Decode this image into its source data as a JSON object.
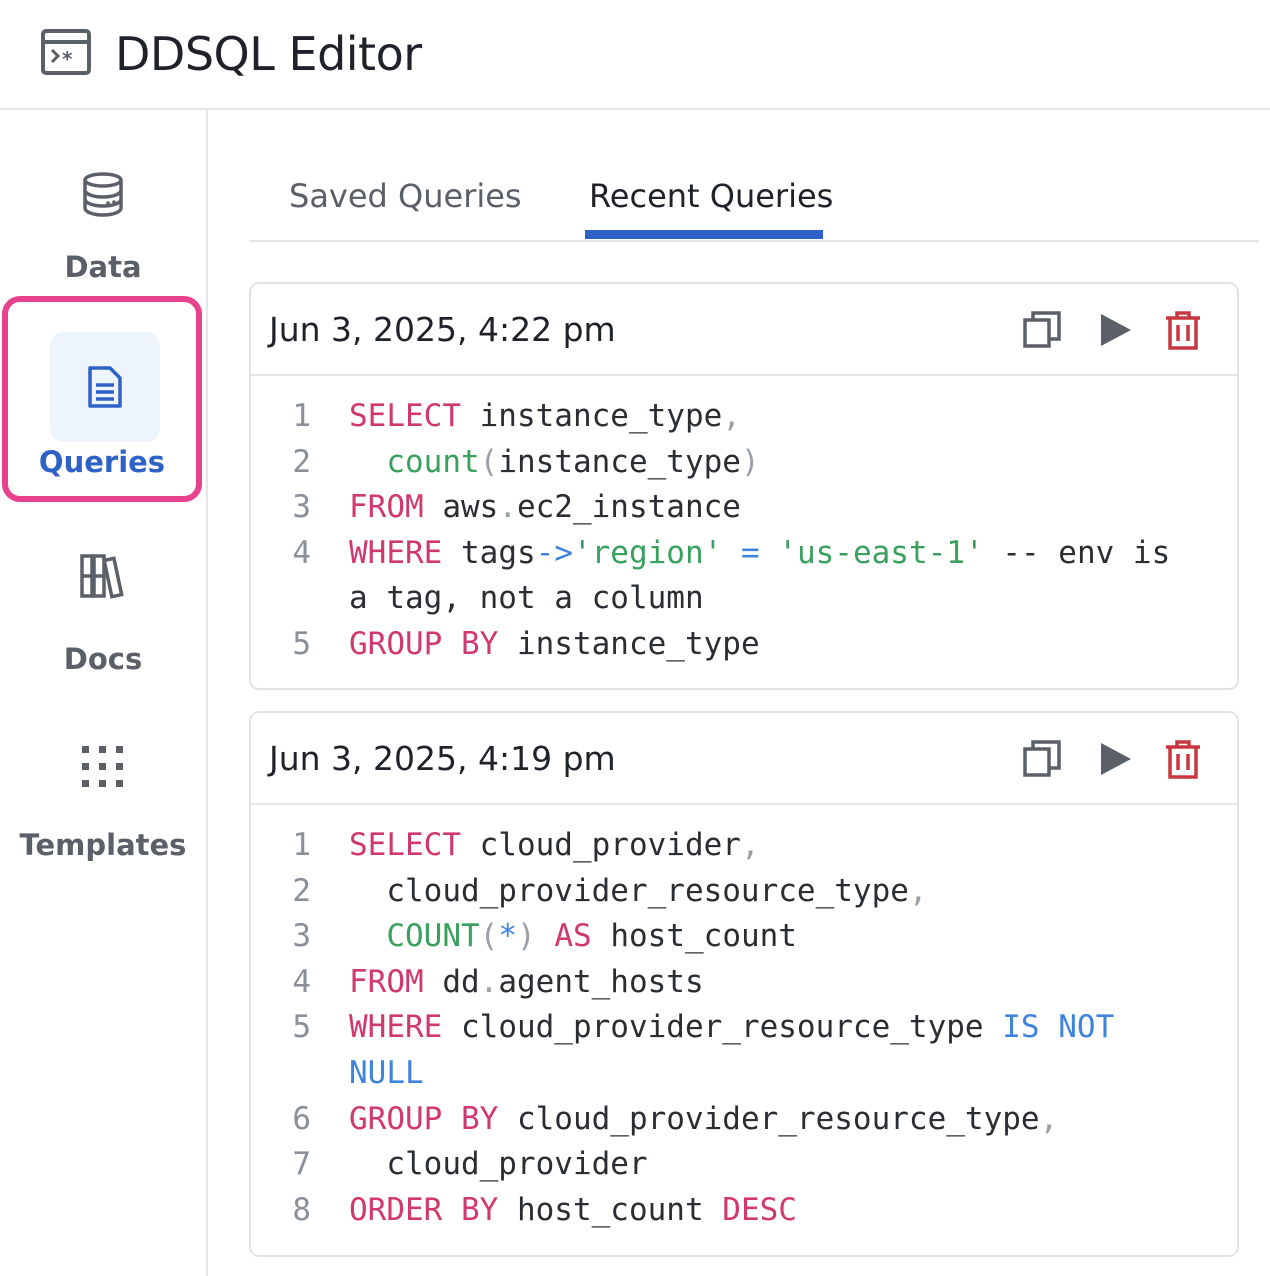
{
  "app": {
    "title": "DDSQL Editor"
  },
  "sidebar": {
    "items": [
      {
        "label": "Data",
        "icon": "database-icon"
      },
      {
        "label": "Queries",
        "icon": "document-icon",
        "active": true
      },
      {
        "label": "Docs",
        "icon": "books-icon"
      },
      {
        "label": "Templates",
        "icon": "grid-icon"
      }
    ]
  },
  "tabs": [
    {
      "label": "Saved Queries",
      "active": false
    },
    {
      "label": "Recent Queries",
      "active": true
    }
  ],
  "colors": {
    "accent": "#2f62c6",
    "highlight": "#e8418e",
    "keyword": "#d0386e",
    "function": "#3aa05e",
    "operator": "#3f84dc",
    "delete": "#c8373f"
  },
  "queries": [
    {
      "timestamp": "Jun 3, 2025, 4:22 pm",
      "lines": [
        {
          "num": "1",
          "tokens": [
            {
              "t": "SELECT",
              "c": "kw"
            },
            {
              "t": " instance_type",
              "c": ""
            },
            {
              "t": ",",
              "c": "pn"
            }
          ]
        },
        {
          "num": "2",
          "tokens": [
            {
              "t": "  ",
              "c": ""
            },
            {
              "t": "count",
              "c": "fn"
            },
            {
              "t": "(",
              "c": "pn"
            },
            {
              "t": "instance_type",
              "c": ""
            },
            {
              "t": ")",
              "c": "pn"
            }
          ]
        },
        {
          "num": "3",
          "tokens": [
            {
              "t": "FROM",
              "c": "kw"
            },
            {
              "t": " aws",
              "c": ""
            },
            {
              "t": ".",
              "c": "pn"
            },
            {
              "t": "ec2_instance",
              "c": ""
            }
          ]
        },
        {
          "num": "4",
          "tokens": [
            {
              "t": "WHERE",
              "c": "kw"
            },
            {
              "t": " tags",
              "c": ""
            },
            {
              "t": "->",
              "c": "op"
            },
            {
              "t": "'region'",
              "c": "str"
            },
            {
              "t": " ",
              "c": ""
            },
            {
              "t": "=",
              "c": "op"
            },
            {
              "t": " ",
              "c": ""
            },
            {
              "t": "'us-east-1'",
              "c": "str"
            },
            {
              "t": " -- env is",
              "c": "cm"
            }
          ]
        },
        {
          "num": "",
          "tokens": [
            {
              "t": "a tag, not a column",
              "c": "cm"
            }
          ]
        },
        {
          "num": "5",
          "tokens": [
            {
              "t": "GROUP BY",
              "c": "kw"
            },
            {
              "t": " instance_type",
              "c": ""
            }
          ]
        }
      ]
    },
    {
      "timestamp": "Jun 3, 2025, 4:19 pm",
      "lines": [
        {
          "num": "1",
          "tokens": [
            {
              "t": "SELECT",
              "c": "kw"
            },
            {
              "t": " cloud_provider",
              "c": ""
            },
            {
              "t": ",",
              "c": "pn"
            }
          ]
        },
        {
          "num": "2",
          "tokens": [
            {
              "t": "  cloud_provider_resource_type",
              "c": ""
            },
            {
              "t": ",",
              "c": "pn"
            }
          ]
        },
        {
          "num": "3",
          "tokens": [
            {
              "t": "  ",
              "c": ""
            },
            {
              "t": "COUNT",
              "c": "fn"
            },
            {
              "t": "(",
              "c": "pn"
            },
            {
              "t": "*",
              "c": "op"
            },
            {
              "t": ")",
              "c": "pn"
            },
            {
              "t": " ",
              "c": ""
            },
            {
              "t": "AS",
              "c": "kw"
            },
            {
              "t": " host_count",
              "c": ""
            }
          ]
        },
        {
          "num": "4",
          "tokens": [
            {
              "t": "FROM",
              "c": "kw"
            },
            {
              "t": " dd",
              "c": ""
            },
            {
              "t": ".",
              "c": "pn"
            },
            {
              "t": "agent_hosts",
              "c": ""
            }
          ]
        },
        {
          "num": "5",
          "tokens": [
            {
              "t": "WHERE",
              "c": "kw"
            },
            {
              "t": " cloud_provider_resource_type ",
              "c": ""
            },
            {
              "t": "IS NOT",
              "c": "op"
            }
          ]
        },
        {
          "num": "",
          "tokens": [
            {
              "t": "NULL",
              "c": "op"
            }
          ]
        },
        {
          "num": "6",
          "tokens": [
            {
              "t": "GROUP BY",
              "c": "kw"
            },
            {
              "t": " cloud_provider_resource_type",
              "c": ""
            },
            {
              "t": ",",
              "c": "pn"
            }
          ]
        },
        {
          "num": "7",
          "tokens": [
            {
              "t": "  cloud_provider",
              "c": ""
            }
          ]
        },
        {
          "num": "8",
          "tokens": [
            {
              "t": "ORDER BY",
              "c": "kw"
            },
            {
              "t": " host_count ",
              "c": ""
            },
            {
              "t": "DESC",
              "c": "kw"
            }
          ]
        }
      ]
    }
  ]
}
